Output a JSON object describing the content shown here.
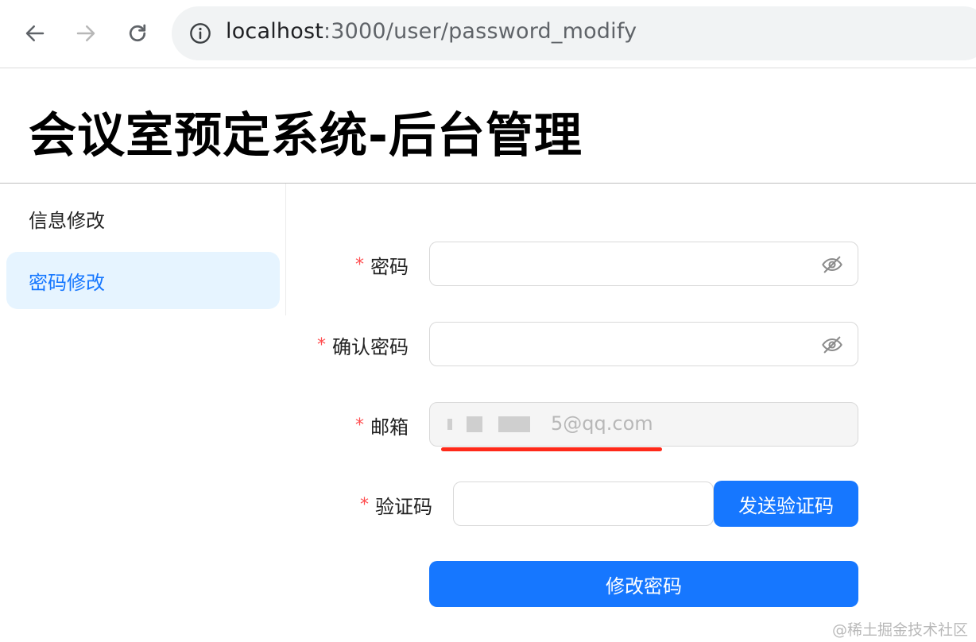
{
  "browser": {
    "url_host": "localhost",
    "url_path": ":3000/user/password_modify",
    "icons": {
      "back": "arrow-left-icon",
      "forward": "arrow-right-icon",
      "reload": "reload-icon",
      "site_info": "info-icon"
    }
  },
  "header": {
    "title": "会议室预定系统-后台管理"
  },
  "sidebar": {
    "items": [
      {
        "label": "信息修改",
        "selected": false
      },
      {
        "label": "密码修改",
        "selected": true
      }
    ]
  },
  "form": {
    "required_mark": "*",
    "password": {
      "label": "密码",
      "value": "",
      "icon": "eye-hidden-icon"
    },
    "confirm_password": {
      "label": "确认密码",
      "value": "",
      "icon": "eye-hidden-icon"
    },
    "email": {
      "label": "邮箱",
      "visible_value": "5@qq.com",
      "disabled": true
    },
    "captcha": {
      "label": "验证码",
      "value": "",
      "send_button": "发送验证码"
    },
    "submit_button": "修改密码"
  },
  "watermark": "@稀土掘金技术社区",
  "colors": {
    "primary": "#1677ff",
    "selected_bg": "#e6f4ff",
    "required": "#ff4d4f",
    "annotation": "#ff2a1a"
  }
}
